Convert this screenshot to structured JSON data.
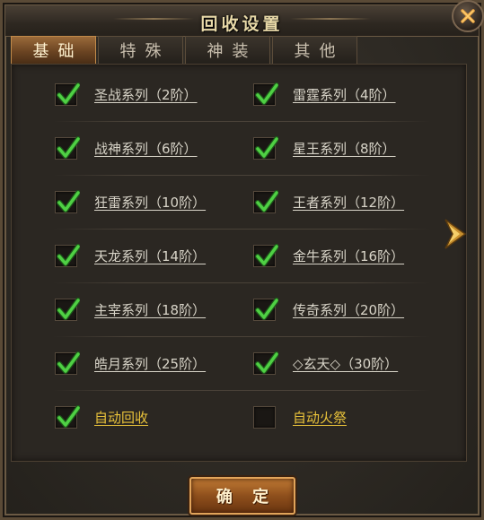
{
  "window": {
    "title": "回收设置",
    "close_icon": "close-x-icon"
  },
  "tabs": [
    {
      "label": "基础",
      "active": true
    },
    {
      "label": "特殊",
      "active": false
    },
    {
      "label": "神装",
      "active": false
    },
    {
      "label": "其他",
      "active": false
    }
  ],
  "options": [
    {
      "label": "圣战系列（2阶）",
      "checked": true
    },
    {
      "label": "雷霆系列（4阶）",
      "checked": true
    },
    {
      "label": "战神系列（6阶）",
      "checked": true
    },
    {
      "label": "星王系列（8阶）",
      "checked": true
    },
    {
      "label": "狂雷系列（10阶）",
      "checked": true
    },
    {
      "label": "王者系列（12阶）",
      "checked": true
    },
    {
      "label": "天龙系列（14阶）",
      "checked": true
    },
    {
      "label": "金牛系列（16阶）",
      "checked": true
    },
    {
      "label": "主宰系列（18阶）",
      "checked": true
    },
    {
      "label": "传奇系列（20阶）",
      "checked": true
    },
    {
      "label": "皓月系列（25阶）",
      "checked": true
    },
    {
      "label": "◇玄天◇（30阶）",
      "checked": true
    }
  ],
  "auto": [
    {
      "label": "自动回收",
      "checked": true
    },
    {
      "label": "自动火祭",
      "checked": false
    }
  ],
  "next_page_icon": "arrow-right-icon",
  "confirm_label": "确 定",
  "colors": {
    "gold": "#e8c23a",
    "check": "#3fb83a",
    "accent": "#c07a34"
  }
}
